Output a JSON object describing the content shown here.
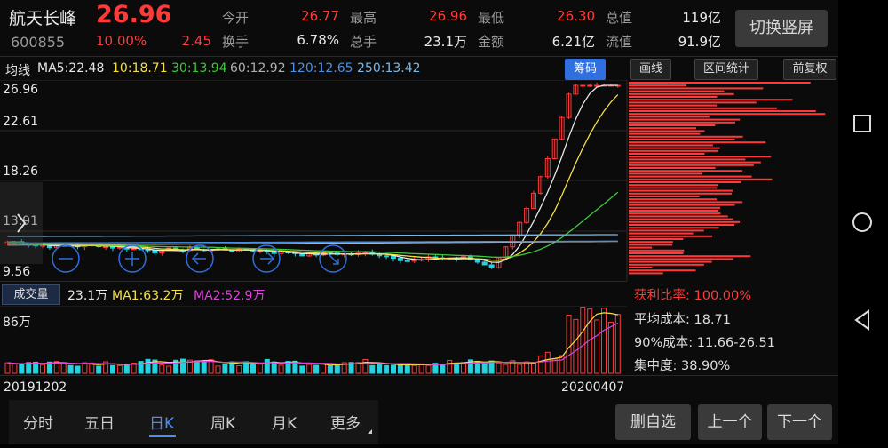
{
  "stock": {
    "name": "航天长峰",
    "code": "600855",
    "price": "26.96",
    "change_pct": "10.00%",
    "change_amt": "2.45"
  },
  "quote": [
    {
      "label": "今开",
      "value": "26.77",
      "color": "red"
    },
    {
      "label": "最高",
      "value": "26.96",
      "color": "red"
    },
    {
      "label": "最低",
      "value": "26.30",
      "color": "red"
    },
    {
      "label": "总值",
      "value": "119亿",
      "color": "white"
    },
    {
      "label": "换手",
      "value": "6.78%",
      "color": "white"
    },
    {
      "label": "总手",
      "value": "23.1万",
      "color": "white"
    },
    {
      "label": "金额",
      "value": "6.21亿",
      "color": "white"
    },
    {
      "label": "流值",
      "value": "91.9亿",
      "color": "white"
    }
  ],
  "switch_button": "切换竖屏",
  "ma_bar": {
    "label": "均线",
    "items": [
      {
        "text": "MA5:22.48",
        "color": "#e8e8e8"
      },
      {
        "text": "10:18.71",
        "color": "#f5e042"
      },
      {
        "text": "30:13.94",
        "color": "#3cc83c"
      },
      {
        "text": "60:12.92",
        "color": "#b0b0b0"
      },
      {
        "text": "120:12.65",
        "color": "#4a90e2"
      },
      {
        "text": "250:13.42",
        "color": "#7ab8e8"
      }
    ]
  },
  "toolbar": {
    "chips": "筹码",
    "draw": "画线",
    "range": "区间统计",
    "adjust": "前复权"
  },
  "price_axis": [
    "26.96",
    "22.61",
    "18.26",
    "13.91",
    "9.56"
  ],
  "volume_bar": {
    "label": "成交量",
    "value": "23.1万",
    "ma1": "MA1:63.2万",
    "ma2": "MA2:52.9万",
    "axis_top": "86万"
  },
  "chip_stats": {
    "profit_ratio": "获利比率: 100.00%",
    "avg_cost": "平均成本: 18.71",
    "cost_90": "90%成本: 11.66-26.51",
    "concentration": "集中度: 38.90%"
  },
  "dates": {
    "start": "20191202",
    "end": "20200407"
  },
  "tabs": [
    "分时",
    "五日",
    "日K",
    "周K",
    "月K",
    "更多"
  ],
  "active_tab": "日K",
  "actions": {
    "delete": "删自选",
    "prev": "上一个",
    "next": "下一个"
  },
  "colors": {
    "up": "#ff3a3a",
    "down": "#22d3e0",
    "accent": "#2f6fe0"
  },
  "icons": [
    "zoom-out-icon",
    "zoom-in-icon",
    "scroll-left-icon",
    "scroll-right-icon",
    "sidebar-expand-icon",
    "square-nav-icon",
    "circle-nav-icon",
    "back-nav-icon"
  ]
}
